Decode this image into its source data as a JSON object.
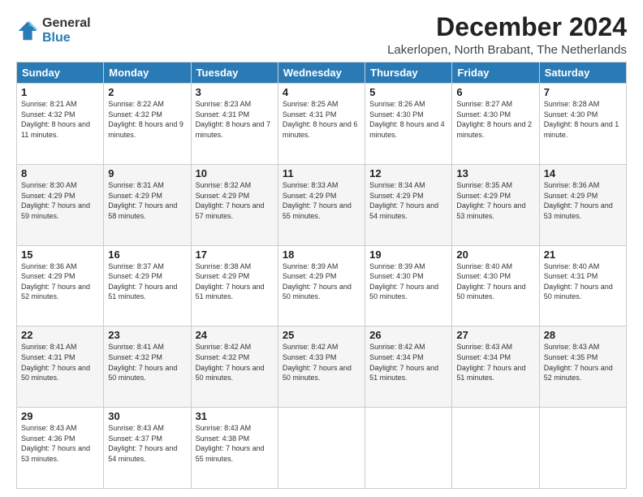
{
  "logo": {
    "general": "General",
    "blue": "Blue"
  },
  "title": "December 2024",
  "subtitle": "Lakerlopen, North Brabant, The Netherlands",
  "headers": [
    "Sunday",
    "Monday",
    "Tuesday",
    "Wednesday",
    "Thursday",
    "Friday",
    "Saturday"
  ],
  "weeks": [
    [
      {
        "day": "1",
        "sunrise": "8:21 AM",
        "sunset": "4:32 PM",
        "daylight": "8 hours and 11 minutes."
      },
      {
        "day": "2",
        "sunrise": "8:22 AM",
        "sunset": "4:32 PM",
        "daylight": "8 hours and 9 minutes."
      },
      {
        "day": "3",
        "sunrise": "8:23 AM",
        "sunset": "4:31 PM",
        "daylight": "8 hours and 7 minutes."
      },
      {
        "day": "4",
        "sunrise": "8:25 AM",
        "sunset": "4:31 PM",
        "daylight": "8 hours and 6 minutes."
      },
      {
        "day": "5",
        "sunrise": "8:26 AM",
        "sunset": "4:30 PM",
        "daylight": "8 hours and 4 minutes."
      },
      {
        "day": "6",
        "sunrise": "8:27 AM",
        "sunset": "4:30 PM",
        "daylight": "8 hours and 2 minutes."
      },
      {
        "day": "7",
        "sunrise": "8:28 AM",
        "sunset": "4:30 PM",
        "daylight": "8 hours and 1 minute."
      }
    ],
    [
      {
        "day": "8",
        "sunrise": "8:30 AM",
        "sunset": "4:29 PM",
        "daylight": "7 hours and 59 minutes."
      },
      {
        "day": "9",
        "sunrise": "8:31 AM",
        "sunset": "4:29 PM",
        "daylight": "7 hours and 58 minutes."
      },
      {
        "day": "10",
        "sunrise": "8:32 AM",
        "sunset": "4:29 PM",
        "daylight": "7 hours and 57 minutes."
      },
      {
        "day": "11",
        "sunrise": "8:33 AM",
        "sunset": "4:29 PM",
        "daylight": "7 hours and 55 minutes."
      },
      {
        "day": "12",
        "sunrise": "8:34 AM",
        "sunset": "4:29 PM",
        "daylight": "7 hours and 54 minutes."
      },
      {
        "day": "13",
        "sunrise": "8:35 AM",
        "sunset": "4:29 PM",
        "daylight": "7 hours and 53 minutes."
      },
      {
        "day": "14",
        "sunrise": "8:36 AM",
        "sunset": "4:29 PM",
        "daylight": "7 hours and 53 minutes."
      }
    ],
    [
      {
        "day": "15",
        "sunrise": "8:36 AM",
        "sunset": "4:29 PM",
        "daylight": "7 hours and 52 minutes."
      },
      {
        "day": "16",
        "sunrise": "8:37 AM",
        "sunset": "4:29 PM",
        "daylight": "7 hours and 51 minutes."
      },
      {
        "day": "17",
        "sunrise": "8:38 AM",
        "sunset": "4:29 PM",
        "daylight": "7 hours and 51 minutes."
      },
      {
        "day": "18",
        "sunrise": "8:39 AM",
        "sunset": "4:29 PM",
        "daylight": "7 hours and 50 minutes."
      },
      {
        "day": "19",
        "sunrise": "8:39 AM",
        "sunset": "4:30 PM",
        "daylight": "7 hours and 50 minutes."
      },
      {
        "day": "20",
        "sunrise": "8:40 AM",
        "sunset": "4:30 PM",
        "daylight": "7 hours and 50 minutes."
      },
      {
        "day": "21",
        "sunrise": "8:40 AM",
        "sunset": "4:31 PM",
        "daylight": "7 hours and 50 minutes."
      }
    ],
    [
      {
        "day": "22",
        "sunrise": "8:41 AM",
        "sunset": "4:31 PM",
        "daylight": "7 hours and 50 minutes."
      },
      {
        "day": "23",
        "sunrise": "8:41 AM",
        "sunset": "4:32 PM",
        "daylight": "7 hours and 50 minutes."
      },
      {
        "day": "24",
        "sunrise": "8:42 AM",
        "sunset": "4:32 PM",
        "daylight": "7 hours and 50 minutes."
      },
      {
        "day": "25",
        "sunrise": "8:42 AM",
        "sunset": "4:33 PM",
        "daylight": "7 hours and 50 minutes."
      },
      {
        "day": "26",
        "sunrise": "8:42 AM",
        "sunset": "4:34 PM",
        "daylight": "7 hours and 51 minutes."
      },
      {
        "day": "27",
        "sunrise": "8:43 AM",
        "sunset": "4:34 PM",
        "daylight": "7 hours and 51 minutes."
      },
      {
        "day": "28",
        "sunrise": "8:43 AM",
        "sunset": "4:35 PM",
        "daylight": "7 hours and 52 minutes."
      }
    ],
    [
      {
        "day": "29",
        "sunrise": "8:43 AM",
        "sunset": "4:36 PM",
        "daylight": "7 hours and 53 minutes."
      },
      {
        "day": "30",
        "sunrise": "8:43 AM",
        "sunset": "4:37 PM",
        "daylight": "7 hours and 54 minutes."
      },
      {
        "day": "31",
        "sunrise": "8:43 AM",
        "sunset": "4:38 PM",
        "daylight": "7 hours and 55 minutes."
      },
      null,
      null,
      null,
      null
    ]
  ],
  "labels": {
    "sunrise": "Sunrise:",
    "sunset": "Sunset:",
    "daylight": "Daylight:"
  }
}
